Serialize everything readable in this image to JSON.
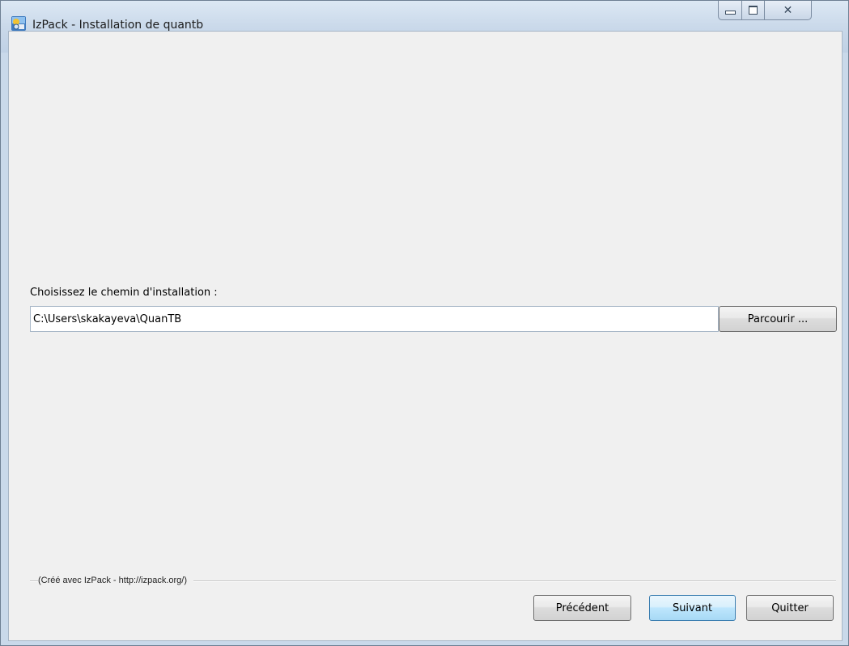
{
  "window": {
    "title": "IzPack - Installation de quantb",
    "icon": "izpack-installer-icon",
    "controls": {
      "minimize": "minimize-icon",
      "maximize": "maximize-icon",
      "close": "close-icon"
    }
  },
  "main": {
    "path_label": "Choisissez le chemin d'installation :",
    "path_value": "C:\\Users\\skakayeva\\QuanTB",
    "browse_label": "Parcourir ..."
  },
  "footer": {
    "credit": "(Créé avec IzPack - http://izpack.org/)",
    "prev_label": "Précédent",
    "next_label": "Suivant",
    "quit_label": "Quitter"
  },
  "colors": {
    "titlebar": "#cad9ea",
    "client_bg": "#f0f0f0",
    "default_button": "#bee6fd"
  }
}
